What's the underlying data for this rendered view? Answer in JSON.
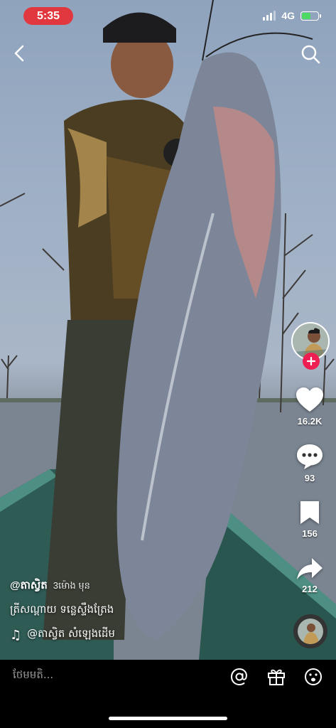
{
  "status_bar": {
    "time": "5:35",
    "network": "4G"
  },
  "nav": {
    "back_icon": "chevron-left-icon",
    "search_icon": "search-icon"
  },
  "actions": {
    "likes": "16.2K",
    "comments": "93",
    "saves": "156",
    "shares": "212"
  },
  "caption": {
    "username": "@តាស្វិត",
    "time_ago": "3ម៉ោង មុន",
    "description": "ត្រីសណ្ដាយ ទន្លេស្ទឹងត្រែង",
    "music_icon": "♫",
    "music": "@តាស្វិត សំឡេងដើម"
  },
  "comment_bar": {
    "placeholder": "ថែមមតិ..."
  },
  "colors": {
    "accent_red": "#ee1d52",
    "time_pill": "#e0383e",
    "battery": "#4cd964"
  }
}
